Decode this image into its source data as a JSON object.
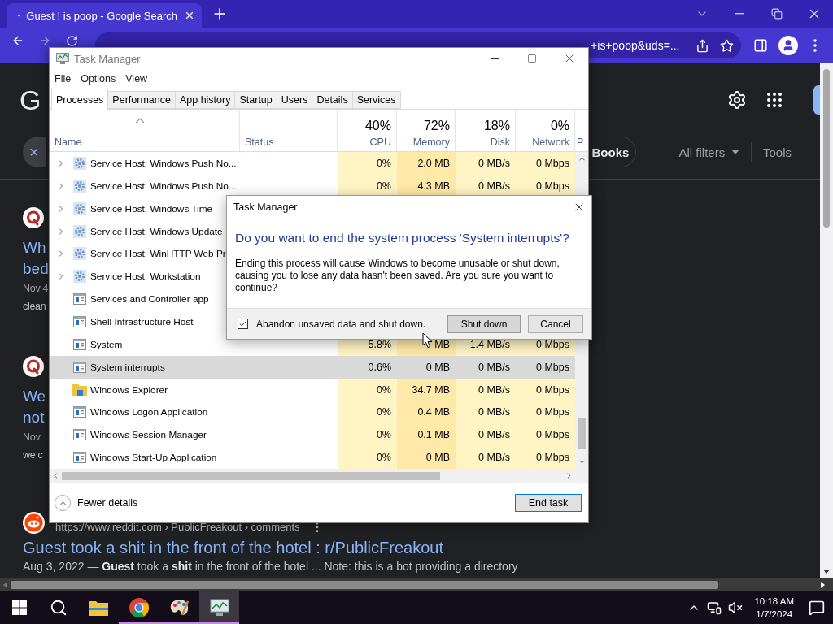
{
  "browser": {
    "tabs": [
      {
        "title": "Guest ! is poop - Google Search",
        "selected": true
      }
    ],
    "nav": [
      {
        "kind": "back",
        "disabled": false
      },
      {
        "kind": "forward",
        "disabled": true
      },
      {
        "kind": "reload",
        "disabled": false
      }
    ],
    "address": "+is+poop&uds=..."
  },
  "google": {
    "logo": "G",
    "clear_chip": "×",
    "books_chip": "Books",
    "all_filters": "All filters",
    "tools": "Tools",
    "results": [
      {
        "kind": "quora",
        "title_lines": [
          "Wh",
          "bed"
        ],
        "date": "Nov 4",
        "snippet": "clean"
      },
      {
        "kind": "quora",
        "title_lines": [
          "We",
          "not"
        ],
        "date": "Nov",
        "snippet": "we c"
      },
      {
        "kind": "reddit",
        "url": "https://www.reddit.com › PublicFreakout › comments",
        "title": "Guest took a shit in the front of the hotel : r/PublicFreakout",
        "snippet": "Aug 3, 2022 — **Guest** took a **shit** in the front of the hotel ... Note: this is a bot providing a directory"
      }
    ]
  },
  "task_manager": {
    "title": "Task Manager",
    "menu": [
      "File",
      "Options",
      "View"
    ],
    "tabs": [
      {
        "label": "Processes",
        "selected": true
      },
      {
        "label": "Performance",
        "selected": false
      },
      {
        "label": "App history",
        "selected": false
      },
      {
        "label": "Startup",
        "selected": false
      },
      {
        "label": "Users",
        "selected": false
      },
      {
        "label": "Details",
        "selected": false
      },
      {
        "label": "Services",
        "selected": false
      }
    ],
    "columns": [
      {
        "label": "Name"
      },
      {
        "label": "Status"
      },
      {
        "percent": "40%",
        "label": "CPU"
      },
      {
        "percent": "72%",
        "label": "Memory"
      },
      {
        "percent": "18%",
        "label": "Disk"
      },
      {
        "percent": "0%",
        "label": "Network"
      },
      {
        "label": "P"
      }
    ],
    "rows": [
      {
        "kind": "service",
        "name": "Service Host: Windows Push No...",
        "values": [
          "0%",
          "2.0 MB",
          "0 MB/s",
          "0 Mbps"
        ],
        "selected": false
      },
      {
        "kind": "service",
        "name": "Service Host: Windows Push No...",
        "values": [
          "0%",
          "4.3 MB",
          "0 MB/s",
          "0 Mbps"
        ],
        "selected": false
      },
      {
        "kind": "service",
        "name": "Service Host: Windows Time",
        "selected": false
      },
      {
        "kind": "service",
        "name": "Service Host: Windows Update",
        "selected": false
      },
      {
        "kind": "service",
        "name": "Service Host: WinHTTP Web Pr",
        "selected": false
      },
      {
        "kind": "service",
        "name": "Service Host: Workstation",
        "selected": false
      },
      {
        "kind": "app",
        "name": "Services and Controller app",
        "selected": false
      },
      {
        "kind": "app",
        "name": "Shell Infrastructure Host",
        "selected": false
      },
      {
        "kind": "app",
        "name": "System",
        "values": [
          "5.8%",
          "MB",
          "1.4 MB/s",
          "0 Mbps"
        ],
        "selected": false
      },
      {
        "kind": "app",
        "name": "System interrupts",
        "values": [
          "0.6%",
          "0 MB",
          "0 MB/s",
          "0 Mbps"
        ],
        "selected": true
      },
      {
        "kind": "folder",
        "name": "Windows Explorer",
        "values": [
          "0%",
          "34.7 MB",
          "0 MB/s",
          "0 Mbps"
        ],
        "selected": false
      },
      {
        "kind": "app",
        "name": "Windows Logon Application",
        "values": [
          "0%",
          "0.4 MB",
          "0 MB/s",
          "0 Mbps"
        ],
        "selected": false
      },
      {
        "kind": "app",
        "name": "Windows Session Manager",
        "values": [
          "0%",
          "0.1 MB",
          "0 MB/s",
          "0 Mbps"
        ],
        "selected": false
      },
      {
        "kind": "app",
        "name": "Windows Start-Up Application",
        "values": [
          "0%",
          "0 MB",
          "0 MB/s",
          "0 Mbps"
        ],
        "selected": false
      }
    ],
    "fewer_details": "Fewer details",
    "end_task": "End task"
  },
  "dialog": {
    "title": "Task Manager",
    "heading": "Do you want to end the system process 'System interrupts'?",
    "body": "Ending this process will cause Windows to become unusable or shut down, causing you to lose any data hasn't been saved. Are you sure you want to continue?",
    "checkbox": {
      "label": "Abandon unsaved data and shut down.",
      "checked": true
    },
    "buttons": [
      {
        "label": "Shut down",
        "focused": true
      },
      {
        "label": "Cancel",
        "focused": false
      }
    ]
  },
  "taskbar": {
    "apps": [
      {
        "kind": "start",
        "running": false,
        "active": false
      },
      {
        "kind": "search",
        "running": false,
        "active": false
      },
      {
        "kind": "explorer",
        "running": false,
        "active": false
      },
      {
        "kind": "chrome",
        "running": true,
        "active": false
      },
      {
        "kind": "paint",
        "running": true,
        "active": false
      },
      {
        "kind": "taskmgr",
        "running": true,
        "active": true
      }
    ],
    "time": "10:18 AM",
    "date": "1/7/2024"
  }
}
